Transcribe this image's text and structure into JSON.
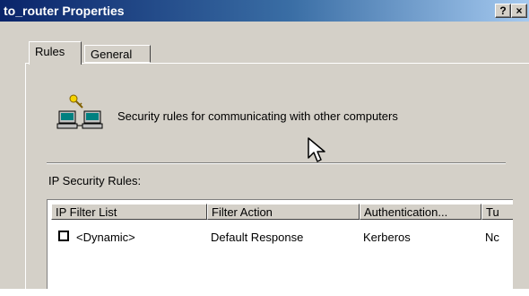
{
  "window": {
    "title": "to_router Properties",
    "help_button": "?",
    "close_button": "×"
  },
  "tabs": [
    {
      "label": "Rules",
      "selected": true
    },
    {
      "label": "General",
      "selected": false
    }
  ],
  "header": {
    "icon": "networked-computers-key-icon",
    "text": "Security rules for communicating with other computers"
  },
  "rules_section": {
    "label": "IP Security Rules:",
    "columns": [
      "IP Filter List",
      "Filter Action",
      "Authentication...",
      "Tu"
    ],
    "rows": [
      {
        "checked": false,
        "filter_list": "<Dynamic>",
        "filter_action": "Default Response",
        "authentication": "Kerberos",
        "tunnel": "Nc"
      }
    ]
  },
  "colors": {
    "titlebar_start": "#0a246a",
    "titlebar_end": "#a6caf0",
    "dialog_face": "#d4d0c8"
  }
}
